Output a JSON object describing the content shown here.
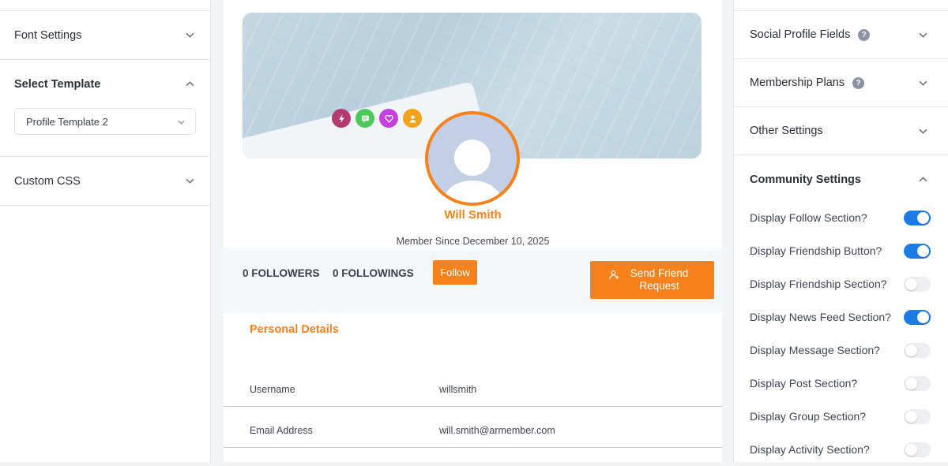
{
  "left_panel": {
    "font_settings": "Font Settings",
    "select_template": "Select Template",
    "template_value": "Profile Template 2",
    "custom_css": "Custom CSS"
  },
  "profile": {
    "name": "Will Smith",
    "member_since": "Member Since December 10, 2025",
    "followers": "0 FOLLOWERS",
    "followings": "0 FOLLOWINGS",
    "follow_button": "Follow",
    "friend_button": "Send Friend Request",
    "personal_details_title": "Personal Details",
    "details": [
      {
        "label": "Username",
        "value": "willsmith"
      },
      {
        "label": "Email Address",
        "value": "will.smith@armember.com"
      }
    ],
    "social_icons": [
      {
        "name": "bolt-icon",
        "color": "#b23a6e"
      },
      {
        "name": "chat-icon",
        "color": "#4cc95a"
      },
      {
        "name": "heart-icon",
        "color": "#c53ee0"
      },
      {
        "name": "user-icon",
        "color": "#f4a21c"
      }
    ],
    "accent_color": "#f7821b"
  },
  "right_panel": {
    "social_profile_fields": "Social Profile Fields",
    "membership_plans": "Membership Plans",
    "other_settings": "Other Settings",
    "community_settings": "Community Settings",
    "help_glyph": "?",
    "toggles": [
      {
        "label": "Display Follow Section?",
        "on": true
      },
      {
        "label": "Display Friendship Button?",
        "on": true
      },
      {
        "label": "Display Friendship Section?",
        "on": false
      },
      {
        "label": "Display News Feed Section?",
        "on": true
      },
      {
        "label": "Display Message Section?",
        "on": false
      },
      {
        "label": "Display Post Section?",
        "on": false
      },
      {
        "label": "Display Group Section?",
        "on": false
      },
      {
        "label": "Display Activity Section?",
        "on": false
      }
    ],
    "toggle_on_color": "#1c7ce6"
  }
}
